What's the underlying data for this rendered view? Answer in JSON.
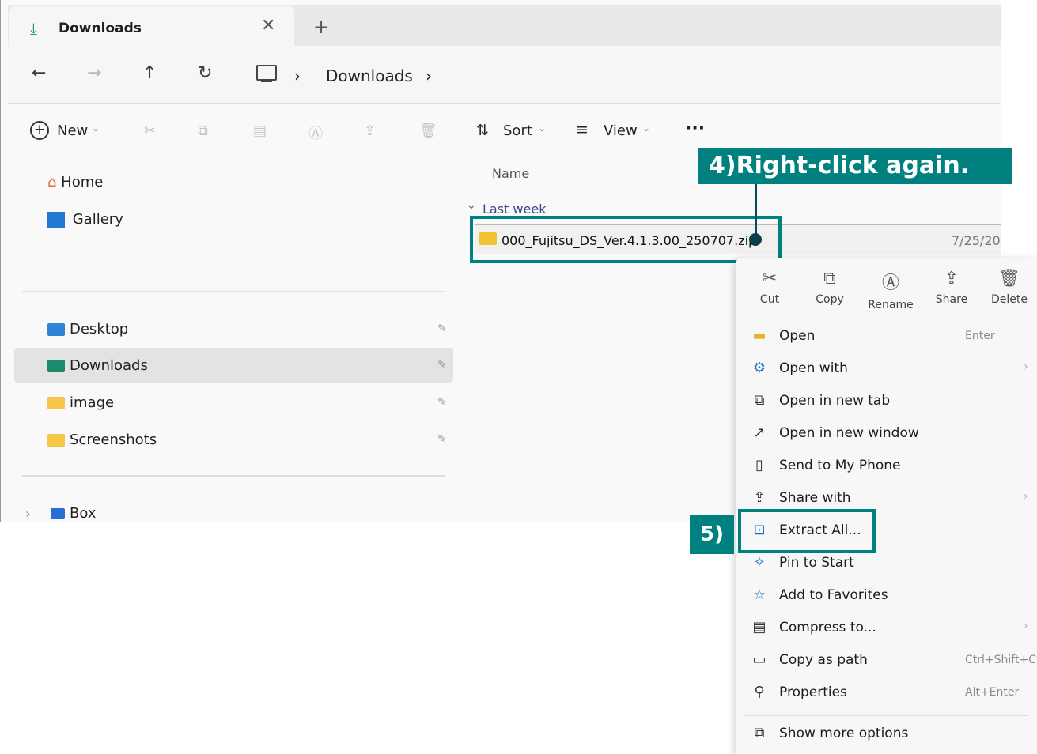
{
  "window": {
    "tab_title": "Downloads",
    "tab_close": "✕",
    "tab_new": "+"
  },
  "nav": {
    "back": "←",
    "forward": "→",
    "up": "↑",
    "refresh": "↻",
    "pc_icon": "computer-icon",
    "chevron1": "›",
    "crumb": "Downloads",
    "chevron2": "›"
  },
  "commandbar": {
    "new_label": "New",
    "sort_label": "Sort",
    "view_label": "View",
    "more": "···"
  },
  "sidebar": {
    "top_items": [
      {
        "label": "Home",
        "icon": "home-icon"
      },
      {
        "label": "Gallery",
        "icon": "gallery-icon"
      }
    ],
    "pinned": [
      {
        "label": "Desktop",
        "icon": "desktop-folder-icon",
        "pin": "📌"
      },
      {
        "label": "Downloads",
        "icon": "downloads-folder-icon",
        "pin": "📌"
      },
      {
        "label": "image",
        "icon": "folder-icon",
        "pin": "📌"
      },
      {
        "label": "Screenshots",
        "icon": "folder-icon",
        "pin": "📌"
      }
    ],
    "box": {
      "label": "Box",
      "expander": "›"
    }
  },
  "content": {
    "column_name": "Name",
    "group_label": "Last week",
    "group_chevron": "⌄",
    "file_name": "000_Fujitsu_DS_Ver.4.1.3.00_250707.zip",
    "file_date": "7/25/20"
  },
  "annotations": {
    "step4": "4)Right-click again.",
    "step5": "5)"
  },
  "context_menu": {
    "quick_actions": [
      {
        "label": "Cut",
        "icon": "cut-icon",
        "glyph": "✂"
      },
      {
        "label": "Copy",
        "icon": "copy-icon",
        "glyph": "⧉"
      },
      {
        "label": "Rename",
        "icon": "rename-icon",
        "glyph": "Ⓐ"
      },
      {
        "label": "Share",
        "icon": "share-icon",
        "glyph": "⇪"
      },
      {
        "label": "Delete",
        "icon": "delete-icon",
        "glyph": "🗑"
      }
    ],
    "items": [
      {
        "label": "Open",
        "shortcut": "Enter",
        "icon": "folder-open-icon",
        "glyph": "▬"
      },
      {
        "label": "Open with",
        "shortcut": "",
        "icon": "open-with-icon",
        "glyph": "⚙"
      },
      {
        "label": "Open in new tab",
        "shortcut": "",
        "icon": "new-tab-icon",
        "glyph": "⧉"
      },
      {
        "label": "Open in new window",
        "shortcut": "",
        "icon": "new-window-icon",
        "glyph": "↗"
      },
      {
        "label": "Send to My Phone",
        "shortcut": "",
        "icon": "phone-icon",
        "glyph": "▯"
      },
      {
        "label": "Share with",
        "shortcut": "",
        "icon": "share-with-icon",
        "glyph": "⇪"
      },
      {
        "label": "Extract All...",
        "shortcut": "",
        "icon": "extract-icon",
        "glyph": "⊡"
      },
      {
        "label": "Pin to Start",
        "shortcut": "",
        "icon": "pin-icon",
        "glyph": "✧"
      },
      {
        "label": "Add to Favorites",
        "shortcut": "",
        "icon": "star-icon",
        "glyph": "☆"
      },
      {
        "label": "Compress to...",
        "shortcut": "",
        "icon": "compress-icon",
        "glyph": "▤"
      },
      {
        "label": "Copy as path",
        "shortcut": "Ctrl+Shift+C",
        "icon": "copy-path-icon",
        "glyph": "▭"
      },
      {
        "label": "Properties",
        "shortcut": "Alt+Enter",
        "icon": "properties-icon",
        "glyph": "⚲"
      },
      {
        "label": "Show more options",
        "shortcut": "",
        "icon": "more-options-icon",
        "glyph": "⧉"
      }
    ]
  },
  "colors": {
    "annotation_teal": "#00807f",
    "selection_gray": "#e3e3e3"
  }
}
